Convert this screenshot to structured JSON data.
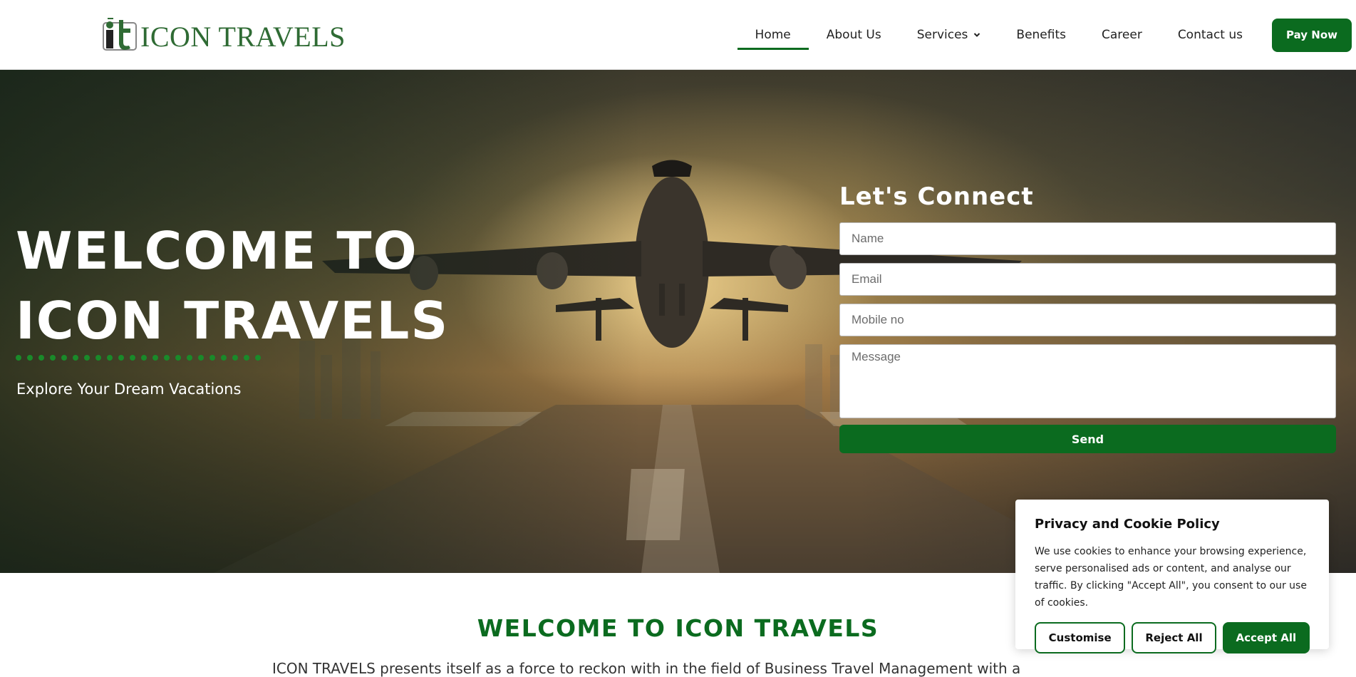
{
  "header": {
    "logo_text": "ICON TRAVELS",
    "nav": [
      {
        "label": "Home"
      },
      {
        "label": "About Us"
      },
      {
        "label": "Services"
      },
      {
        "label": "Benefits"
      },
      {
        "label": "Career"
      },
      {
        "label": "Contact us"
      }
    ],
    "pay_now": "Pay Now"
  },
  "hero": {
    "title_line1": "WELCOME TO",
    "title_line2": "ICON TRAVELS",
    "subtitle": "Explore Your Dream Vacations"
  },
  "form": {
    "title": "Let's Connect",
    "name_placeholder": "Name",
    "email_placeholder": "Email",
    "mobile_placeholder": "Mobile no",
    "message_placeholder": "Message",
    "send": "Send"
  },
  "intro": {
    "title": "WELCOME TO ICON TRAVELS",
    "text": "ICON TRAVELS presents itself as a force to reckon with in the field of Business Travel Management with a"
  },
  "cookie": {
    "title": "Privacy and Cookie Policy",
    "text": "We use cookies to enhance your browsing experience, serve personalised ads or content, and analyse our traffic. By clicking \"Accept All\", you consent to our use of cookies.",
    "customise": "Customise",
    "reject": "Reject All",
    "accept": "Accept All"
  },
  "colors": {
    "brand_green": "#0b6b1f",
    "logo_green": "#2f6b34"
  }
}
